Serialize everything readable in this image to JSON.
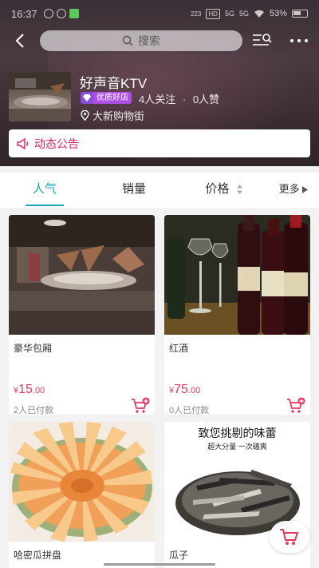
{
  "statusbar": {
    "time": "16:37",
    "net1": "223",
    "badge_hd": "HD",
    "net2": "5G",
    "net3": "5G",
    "battery": "53%"
  },
  "search": {
    "label": "搜索"
  },
  "shop": {
    "name": "好声音KTV",
    "badge": "优质好店",
    "followers": "4人关注",
    "separator": "·",
    "likes": "0人赞",
    "address": "大新购物街"
  },
  "announcement": {
    "label": "动态公告"
  },
  "tabs": {
    "popular": "人气",
    "sales": "销量",
    "price": "价格",
    "more": "更多"
  },
  "products": [
    {
      "name": "豪华包厢",
      "currency": "¥",
      "price_int": "15",
      "price_dec": ".00",
      "paid": "2人已付款"
    },
    {
      "name": "红酒",
      "currency": "¥",
      "price_int": "75",
      "price_dec": ".00",
      "paid": "0人已付款"
    },
    {
      "name": "哈密瓜拼盘"
    },
    {
      "name": "瓜子",
      "image_title": "致您挑剔的味蕾",
      "image_subtitle": "超大分量 一次磕爽"
    }
  ],
  "colors": {
    "accent": "#1aa6b6",
    "price": "#e23a5b",
    "announce": "#d6235f",
    "badge": "#b04fe6"
  }
}
